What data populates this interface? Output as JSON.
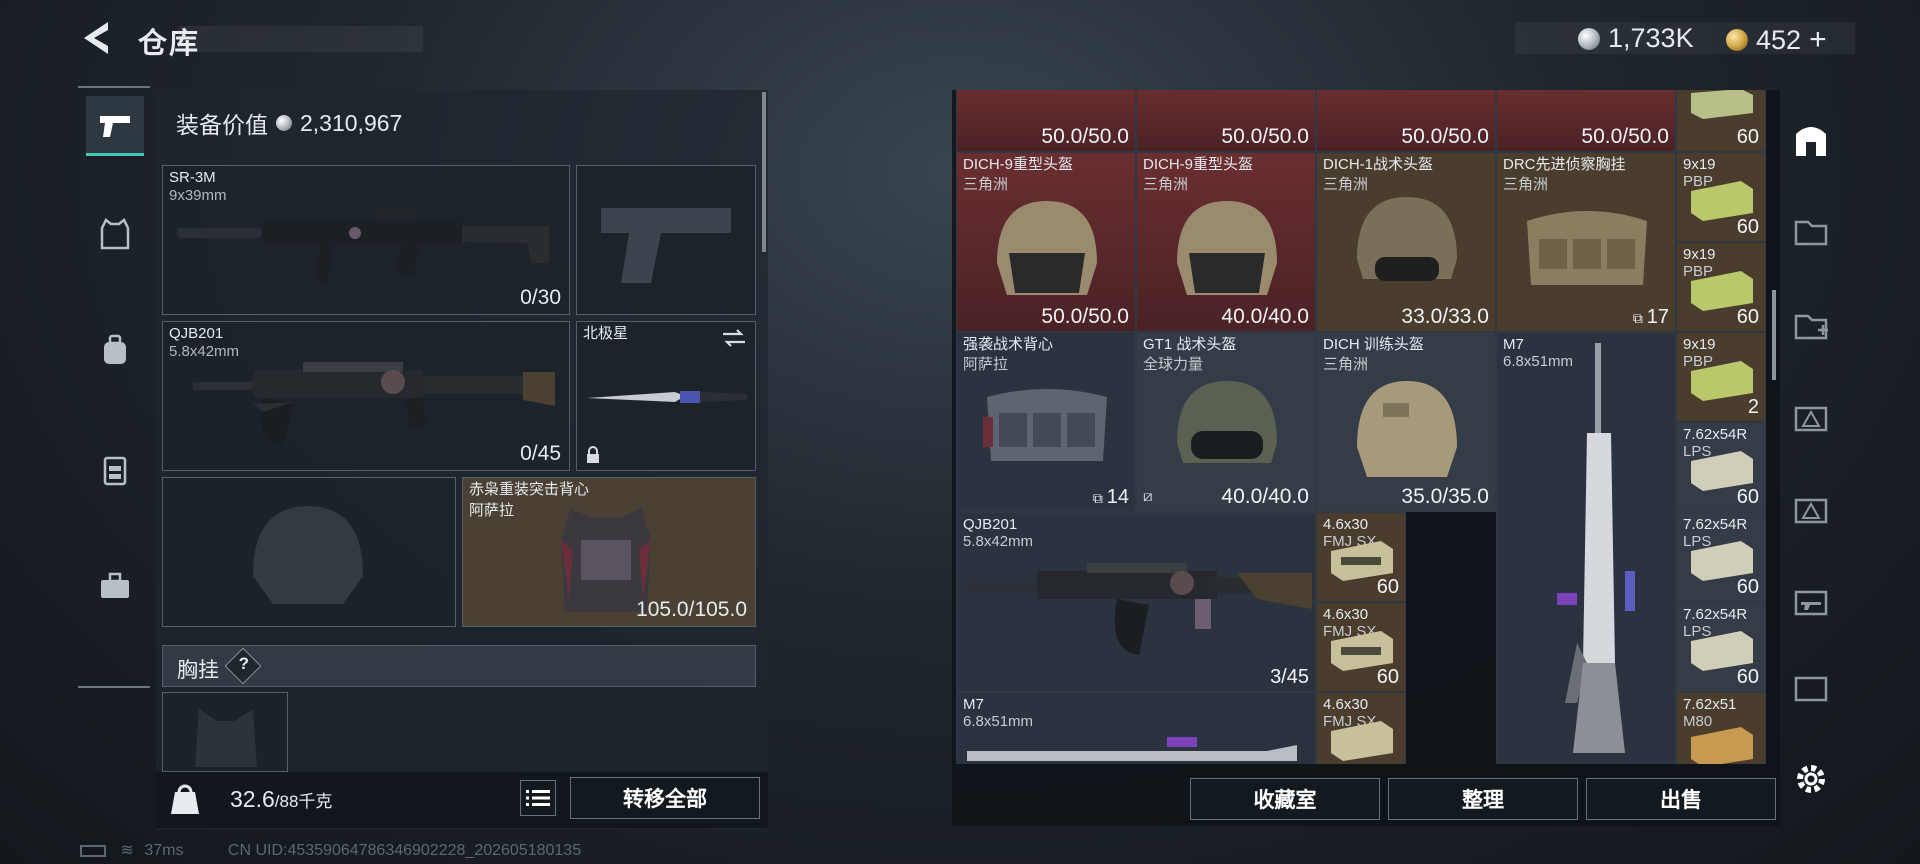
{
  "header": {
    "title": "仓库"
  },
  "currency": {
    "silver": "1,733K",
    "gold": "452",
    "plus": "+"
  },
  "equip_value": {
    "label": "装备价值",
    "value": "2,310,967"
  },
  "slots": {
    "primary": {
      "name": "SR-3M",
      "caliber": "9x39mm",
      "ammo": "0/30"
    },
    "secondary": {
      "name": "QJB201",
      "caliber": "5.8x42mm",
      "ammo": "0/45"
    },
    "melee": {
      "name": "北极星"
    },
    "armor": {
      "name": "赤枭重装突击背心",
      "maker": "阿萨拉",
      "durability": "105.0/105.0"
    },
    "rig_label": "胸挂",
    "rig_help": "?"
  },
  "footer": {
    "weight_current": "32.6",
    "weight_max": "/88千克",
    "transfer_all": "转移全部"
  },
  "status": {
    "ping": "37ms",
    "uid": "CN UID:45359064786346902228_202605180135"
  },
  "stash": {
    "row0": [
      {
        "dur": "50.0/50.0"
      },
      {
        "dur": "50.0/50.0"
      },
      {
        "dur": "50.0/50.0"
      },
      {
        "dur": "50.0/50.0"
      }
    ],
    "row1": [
      {
        "name": "DICH-9重型头盔",
        "sub": "三角洲",
        "dur": "50.0/50.0"
      },
      {
        "name": "DICH-9重型头盔",
        "sub": "三角洲",
        "dur": "40.0/40.0"
      },
      {
        "name": "DICH-1战术头盔",
        "sub": "三角洲",
        "dur": "33.0/33.0"
      },
      {
        "name": "DRC先进侦察胸挂",
        "sub": "三角洲",
        "cnt": "17"
      }
    ],
    "row2": [
      {
        "name": "强袭战术背心",
        "sub": "阿萨拉",
        "cnt": "14"
      },
      {
        "name": "GT1 战术头盔",
        "sub": "全球力量",
        "dur": "40.0/40.0"
      },
      {
        "name": "DICH 训练头盔",
        "sub": "三角洲",
        "dur": "35.0/35.0"
      },
      {
        "name": "M7",
        "sub": "6.8x51mm"
      }
    ],
    "qjb": {
      "name": "QJB201",
      "sub": "5.8x42mm",
      "cnt": "3/45"
    },
    "m7b": {
      "name": "M7",
      "sub": "6.8x51mm"
    },
    "ammo_mid": [
      {
        "name": "4.6x30",
        "sub": "FMJ SX",
        "cnt": "60"
      },
      {
        "name": "4.6x30",
        "sub": "FMJ SX",
        "cnt": "60"
      },
      {
        "name": "4.6x30",
        "sub": "FMJ SX",
        "cnt": ""
      }
    ],
    "ammo_right": [
      {
        "name": "",
        "sub": "",
        "cnt": "60"
      },
      {
        "name": "9x19",
        "sub": "PBP",
        "cnt": "60"
      },
      {
        "name": "9x19",
        "sub": "PBP",
        "cnt": "60"
      },
      {
        "name": "9x19",
        "sub": "PBP",
        "cnt": "2"
      },
      {
        "name": "7.62x54R",
        "sub": "LPS",
        "cnt": "60"
      },
      {
        "name": "7.62x54R",
        "sub": "LPS",
        "cnt": "60"
      },
      {
        "name": "7.62x54R",
        "sub": "LPS",
        "cnt": "60"
      },
      {
        "name": "7.62x51",
        "sub": "M80",
        "cnt": ""
      }
    ]
  },
  "actions": {
    "collection": "收藏室",
    "organize": "整理",
    "sell": "出售"
  },
  "colors": {
    "accent": "#3fc8b6",
    "rarity_red": "#6a2e30",
    "rarity_brown": "#4b3d2e",
    "rarity_gray": "#343c48"
  }
}
